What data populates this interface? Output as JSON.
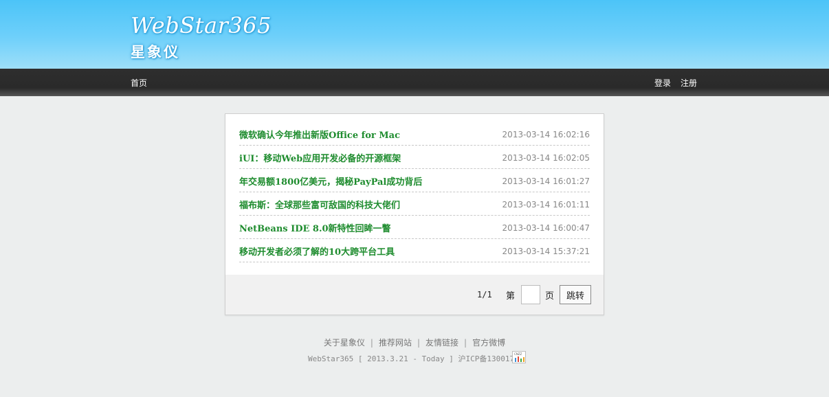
{
  "header": {
    "logo_en": "WebStar365",
    "logo_cn": "星象仪"
  },
  "nav": {
    "home": "首页",
    "login": "登录",
    "register": "注册"
  },
  "articles": [
    {
      "title": "微软确认今年推出新版Office for Mac",
      "date": "2013-03-14 16:02:16"
    },
    {
      "title": "iUI：移动Web应用开发必备的开源框架",
      "date": "2013-03-14 16:02:05"
    },
    {
      "title": "年交易额1800亿美元，揭秘PayPal成功背后",
      "date": "2013-03-14 16:01:27"
    },
    {
      "title": "福布斯：全球那些富可敌国的科技大佬们",
      "date": "2013-03-14 16:01:11"
    },
    {
      "title": "NetBeans IDE 8.0新特性回眸一瞥",
      "date": "2013-03-14 16:00:47"
    },
    {
      "title": "移动开发者必须了解的10大跨平台工具",
      "date": "2013-03-14 15:37:21"
    }
  ],
  "pager": {
    "count": "1/1",
    "prefix": "第",
    "page_value": "",
    "suffix": "页",
    "jump_label": "跳转"
  },
  "footer": {
    "links": [
      "关于星象仪",
      "推荐网站",
      "友情链接",
      "官方微博"
    ],
    "separator": "|",
    "copyright": "WebStar365 [ 2013.3.21 - Today ] 沪ICP备13001734",
    "stats_icon": "bar-chart-icon",
    "stats_icon_label": "CNZZ"
  },
  "colors": {
    "header_blue": "#4cc4f8",
    "navbar": "#2e2e2e",
    "link_green": "#1e8c2e"
  }
}
